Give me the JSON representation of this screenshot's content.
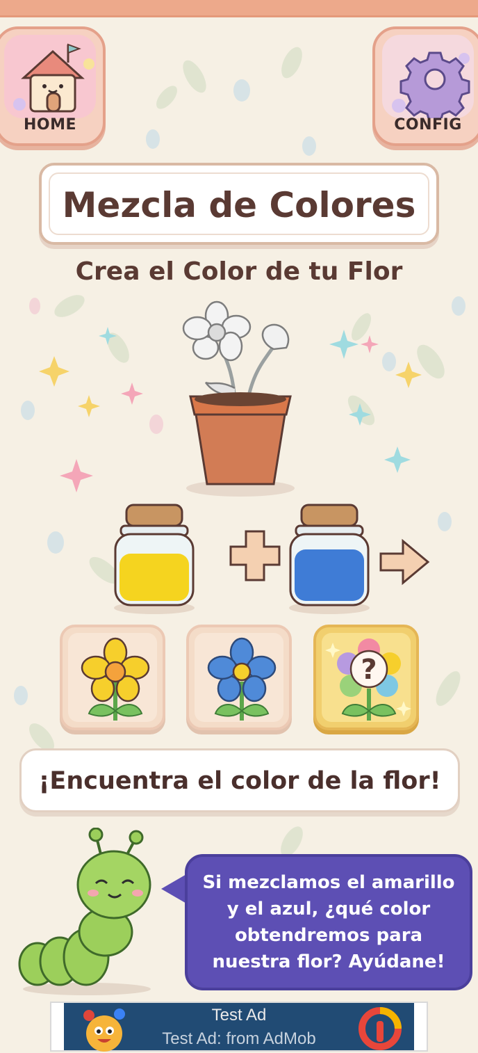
{
  "header": {
    "home_label": "HOME",
    "config_label": "CONFIG"
  },
  "game": {
    "title": "Mezcla de Colores",
    "subtitle": "Crea el Color de tu Flor",
    "jar_left_color": "#f5d41f",
    "jar_right_color": "#3f7cd6",
    "plus_icon": "plus-icon",
    "arrow_icon": "arrow-right-icon",
    "flower_options": [
      {
        "name": "yellow-flower",
        "color": "#f6cf2c"
      },
      {
        "name": "blue-flower",
        "color": "#4f8ad8"
      },
      {
        "name": "mystery-flower",
        "symbol": "?"
      }
    ],
    "instruction": "¡Encuentra el color de la flor!",
    "mascot_speech": "Si mezclamos el amarillo\ny el azul, ¿qué color\nobtendremos para\nnuestra flor? Ayúdane!"
  },
  "ad": {
    "title": "Test Ad",
    "subtitle": "Test Ad: from AdMob"
  },
  "colors": {
    "background": "#f6f0e4",
    "accent_purple": "#5d4fb4",
    "title_brown": "#5a3a33",
    "top_bar": "#eda98b"
  }
}
